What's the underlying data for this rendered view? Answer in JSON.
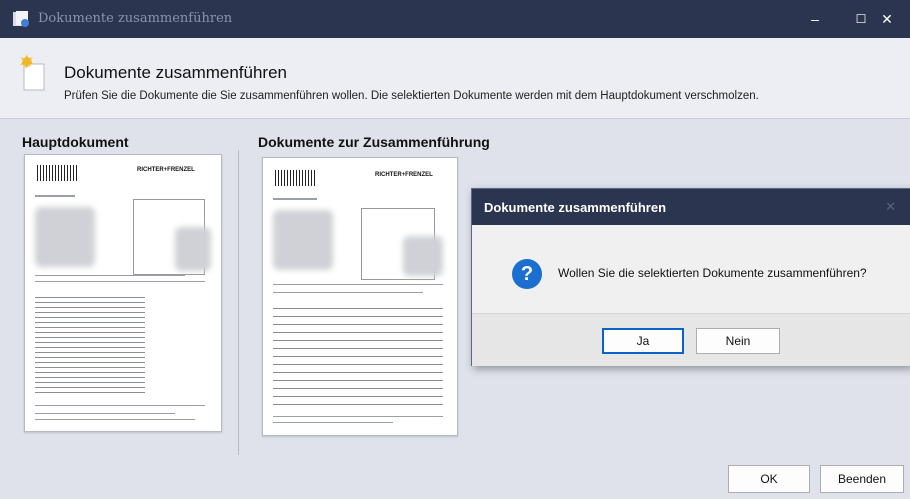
{
  "window": {
    "title": "Dokumente zusammenführen",
    "controls": {
      "minimize": "–",
      "maximize": "☐",
      "close": "✕"
    }
  },
  "header": {
    "title": "Dokumente zusammenführen",
    "description": "Prüfen Sie die Dokumente die Sie zusammenführen wollen. Die selektierten Dokumente werden mit dem Hauptdokument verschmolzen."
  },
  "panels": {
    "main_label": "Hauptdokument",
    "merge_label": "Dokumente zur Zusammenführung",
    "logo_text": "RICHTER+FRENZEL",
    "logo_text_2": "RICHTER+FRENZEL"
  },
  "dialog": {
    "title": "Dokumente zusammenführen",
    "close": "✕",
    "icon": "question-icon",
    "icon_glyph": "?",
    "message": "Wollen Sie die selektierten Dokumente zusammenführen?",
    "yes_label": "Ja",
    "no_label": "Nein"
  },
  "footer": {
    "ok_label": "OK",
    "exit_label": "Beenden"
  },
  "colors": {
    "titlebar": "#2c3550",
    "accent": "#1b6fd1"
  }
}
